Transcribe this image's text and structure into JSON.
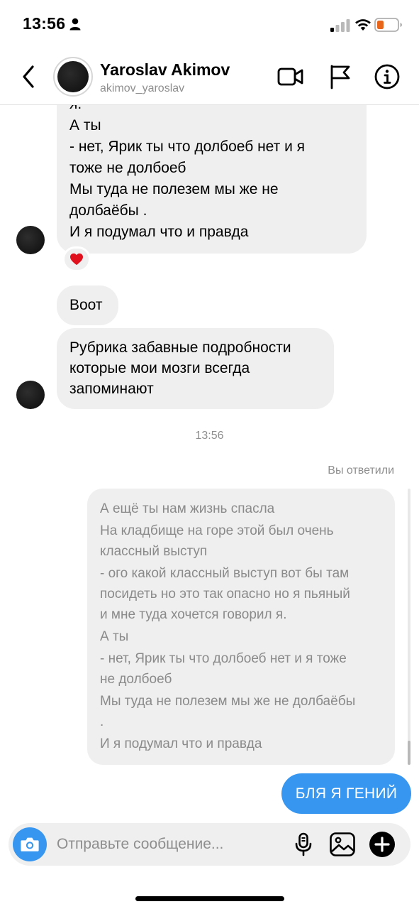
{
  "status_bar": {
    "time": "13:56"
  },
  "header": {
    "name": "Yaroslav Akimov",
    "username": "akimov_yaroslav"
  },
  "messages": {
    "first_bubble_lines": [
      "я.",
      "А ты",
      "- нет, Ярик ты что долбоеб нет и я",
      "тоже не долбоеб",
      "Мы туда не полезем мы же не",
      "долбаёбы .",
      "И я подумал что и правда"
    ],
    "reaction": "❤️",
    "second_bubble": "Воот",
    "third_bubble_lines": [
      "Рубрика забавные подробности",
      "которые мои мозги всегда",
      "запоминают"
    ],
    "timestamp": "13:56",
    "replied_label": "Вы ответили",
    "reply_lines": [
      "А ещё ты нам жизнь спасла",
      "На кладбище на горе этой был очень",
      "классный выступ",
      "- ого какой классный выступ вот бы там",
      "посидеть но это так опасно но я пьяный",
      "и мне туда хочется говорил я.",
      "А ты",
      "- нет, Ярик ты что долбоеб нет и я тоже",
      "не долбоеб",
      "Мы туда не полезем мы же не долбаёбы",
      ".",
      "И я подумал что и правда"
    ],
    "my_message": "БЛЯ Я ГЕНИЙ"
  },
  "composer": {
    "placeholder": "Отправьте сообщение..."
  },
  "colors": {
    "accent": "#3797f0",
    "incoming_bubble": "#efefef",
    "muted_text": "#8e8e8e",
    "battery_low": "#e8661c"
  },
  "icons": [
    "person-icon",
    "signal-icon",
    "wifi-icon",
    "battery-icon",
    "back-chevron-icon",
    "video-call-icon",
    "flag-icon",
    "info-icon",
    "heart-icon",
    "camera-icon",
    "microphone-icon",
    "gallery-icon",
    "plus-icon"
  ]
}
